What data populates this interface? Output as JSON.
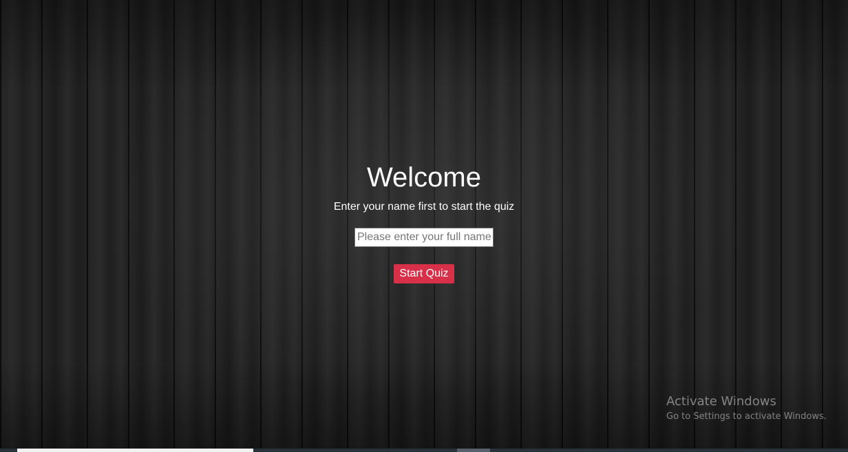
{
  "welcome": {
    "title": "Welcome",
    "subtitle": "Enter your name first to start the quiz",
    "name_input": {
      "value": "",
      "placeholder": "Please enter your full name"
    },
    "start_button_label": "Start Quiz"
  },
  "watermark": {
    "title": "Activate Windows",
    "subtitle": "Go to Settings to activate Windows."
  },
  "colors": {
    "accent_button": "#d9304a",
    "background": "#1b1b1b",
    "text": "#ffffff"
  }
}
